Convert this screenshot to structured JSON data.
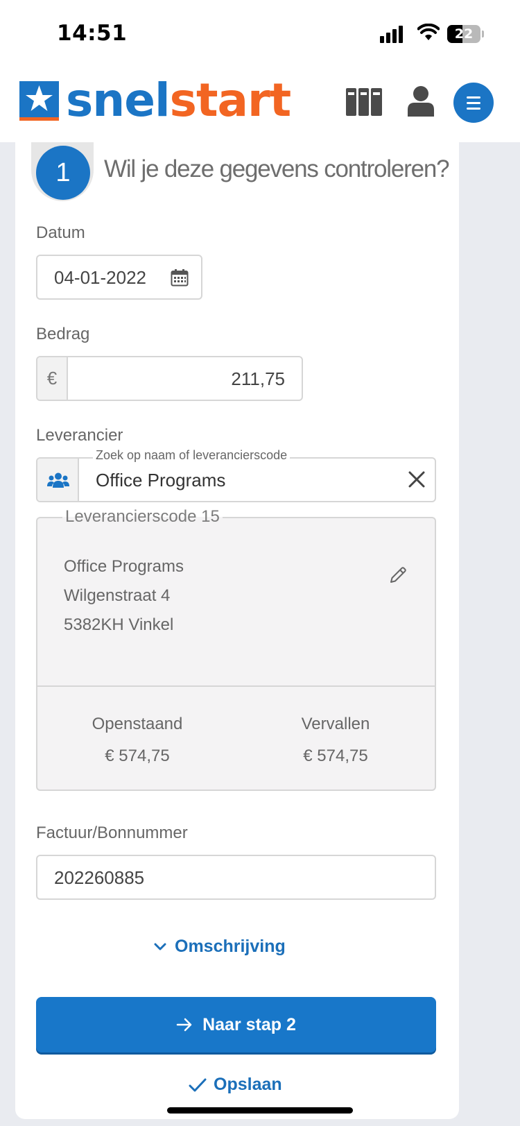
{
  "status_bar": {
    "time": "14:51",
    "battery_level": "22"
  },
  "header": {
    "brand_snel": "snel",
    "brand_start": "start",
    "brand_color": "#1b75c5",
    "accent_color": "#f26522"
  },
  "step": {
    "number": "1",
    "title": "Wil je deze gegevens controleren?"
  },
  "form": {
    "date_label": "Datum",
    "date_value": "04-01-2022",
    "amount_label": "Bedrag",
    "currency_symbol": "€",
    "amount_value": "211,75",
    "supplier_label": "Leverancier",
    "supplier_search_legend": "Zoek op naam of leverancierscode",
    "supplier_value": "Office Programs",
    "invoice_label": "Factuur/Bonnummer",
    "invoice_value": "202260885"
  },
  "supplier_card": {
    "code_legend": "Leverancierscode 15",
    "name": "Office Programs",
    "street": "Wilgenstraat 4",
    "city": "5382KH Vinkel",
    "open_label": "Openstaand",
    "open_amount": "€ 574,75",
    "overdue_label": "Vervallen",
    "overdue_amount": "€ 574,75"
  },
  "actions": {
    "description_toggle": "Omschrijving",
    "next_step": "Naar stap 2",
    "save": "Opslaan"
  }
}
